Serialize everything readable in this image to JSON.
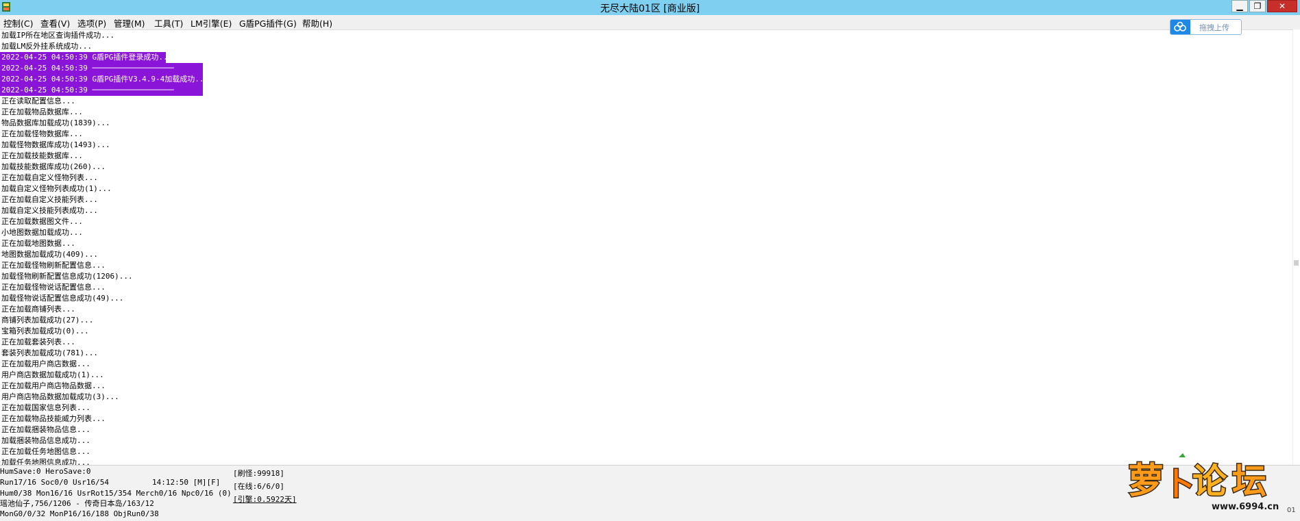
{
  "window": {
    "title": "无尽大陆01区 [商业版]"
  },
  "menu": [
    {
      "label": "控制(C)"
    },
    {
      "label": "查看(V)"
    },
    {
      "label": "选项(P)"
    },
    {
      "label": "管理(M)"
    },
    {
      "label": "工具(T)"
    },
    {
      "label": "LM引擎(E)"
    },
    {
      "label": "G盾PG插件(G)"
    },
    {
      "label": "帮助(H)"
    }
  ],
  "upload": {
    "label": "拖拽上传"
  },
  "highlight_color": "#8a14d8",
  "log": {
    "before": [
      "加载IP所在地区查询插件成功...",
      "加载LM反外挂系统成功..."
    ],
    "highlighted": [
      "2022-04-25 04:50:39 G盾PG插件登录成功...",
      "2022-04-25 04:50:39 ──────────────────",
      "2022-04-25 04:50:39 G盾PG插件V3.4.9-4加载成功...",
      "2022-04-25 04:50:39 ──────────────────"
    ],
    "after": [
      "正在读取配置信息...",
      "正在加载物品数据库...",
      "物品数据库加载成功(1839)...",
      "正在加载怪物数据库...",
      "加载怪物数据库成功(1493)...",
      "正在加载技能数据库...",
      "加载技能数据库成功(260)...",
      "正在加载自定义怪物列表...",
      "加载自定义怪物列表成功(1)...",
      "正在加载自定义技能列表...",
      "加载自定义技能列表成功...",
      "正在加载数据图文件...",
      "小地图数据加载成功...",
      "正在加载地图数据...",
      "地图数据加载成功(409)...",
      "正在加载怪物刷新配置信息...",
      "加载怪物刷新配置信息成功(1206)...",
      "正在加载怪物说话配置信息...",
      "加载怪物说话配置信息成功(49)...",
      "正在加载商铺列表...",
      "商铺列表加载成功(27)...",
      "宝箱列表加载成功(0)...",
      "正在加载套装列表...",
      "套装列表加载成功(781)...",
      "正在加载用户商店数据...",
      "用户商店数据加载成功(1)...",
      "正在加载用户商店物品数据...",
      "用户商店物品数据加载成功(3)...",
      "正在加载国家信息列表...",
      "正在加载物品技能威力列表...",
      "正在加载捆装物品信息...",
      "加载捆装物品信息成功...",
      "正在加载任务地图信息...",
      "加载任务地图信息成功..."
    ]
  },
  "status": {
    "row1": "HumSave:0 HeroSave:0",
    "row2a": "Run17/16 Soc0/0 Usr16/54",
    "time": "14:12:50 [M][F]",
    "row3": "Hum0/38 Mon16/16 UsrRot15/354 Merch0/16 Npc0/16 (0)",
    "row4": "瑶池仙子,756/1206 - 传奇日本岛/163/12",
    "row5": "MonG0/0/32 MonP16/16/188 ObjRun0/38",
    "refresh": "[刷怪:99918]",
    "online": "[在线:6/6/0]",
    "engine": "[引擎:0.5922天]"
  },
  "watermark": {
    "url": "www.6994.cn",
    "logo_text": "萝卜论坛",
    "corner": "01"
  }
}
